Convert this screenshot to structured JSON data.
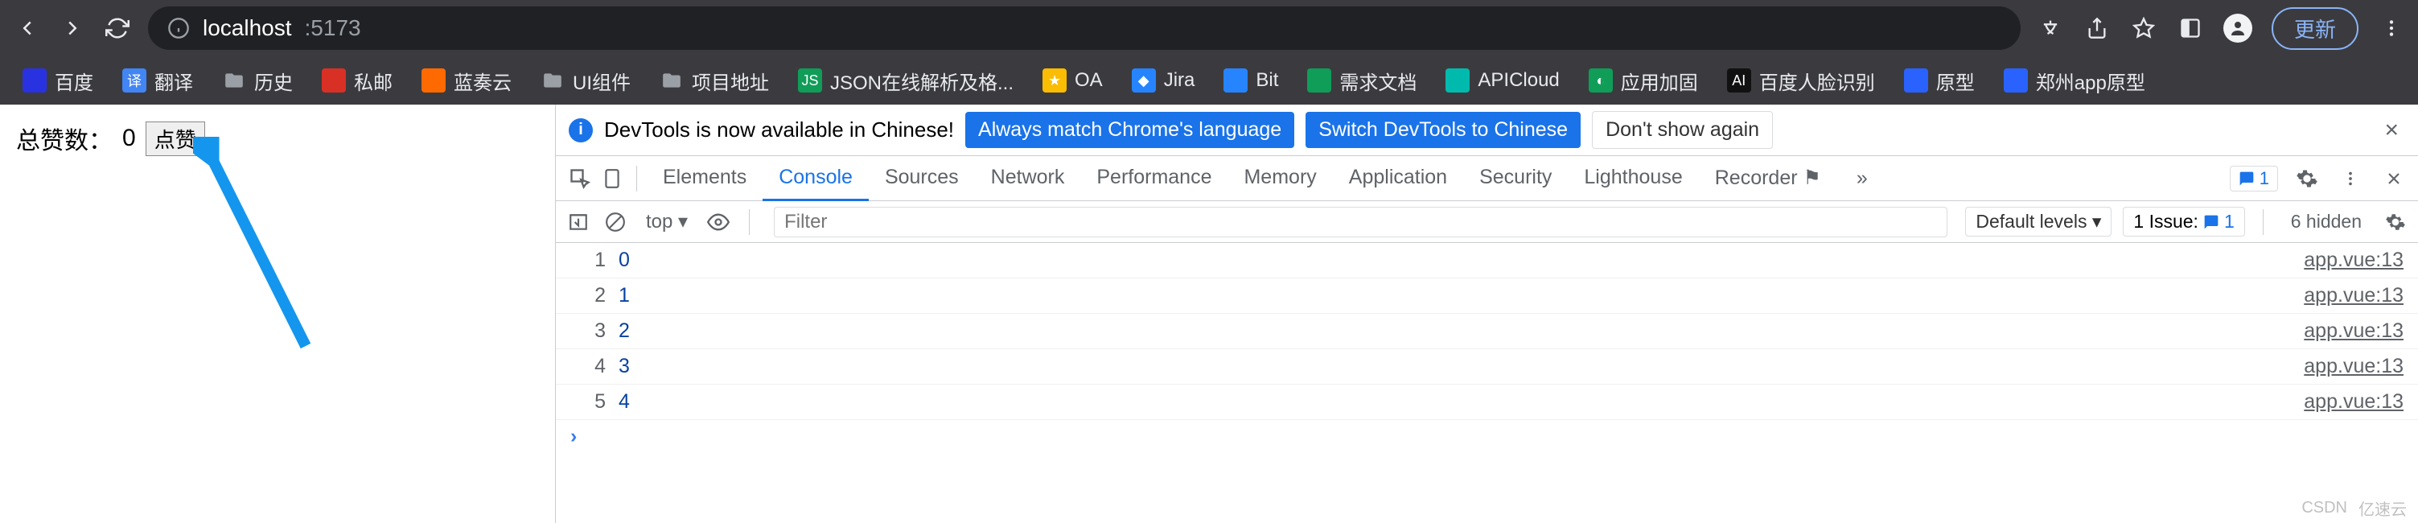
{
  "browser": {
    "url_host": "localhost",
    "url_port": ":5173",
    "update_label": "更新"
  },
  "bookmarks": [
    {
      "label": "百度",
      "color": "#2932e1"
    },
    {
      "label": "翻译",
      "color": "#4285f4",
      "badge": "译"
    },
    {
      "label": "历史",
      "folder": true
    },
    {
      "label": "私邮",
      "color": "#d93025"
    },
    {
      "label": "蓝奏云",
      "color": "#ff6a00"
    },
    {
      "label": "UI组件",
      "folder": true
    },
    {
      "label": "项目地址",
      "folder": true
    },
    {
      "label": "JSON在线解析及格...",
      "color": "#0f9d58",
      "badge": "JS"
    },
    {
      "label": "OA",
      "color": "#fbbc04",
      "badge": "★"
    },
    {
      "label": "Jira",
      "color": "#2684ff",
      "badge": "◆"
    },
    {
      "label": "Bit",
      "color": "#2684ff"
    },
    {
      "label": "需求文档",
      "color": "#0f9d58"
    },
    {
      "label": "APICloud",
      "color": "#00baad"
    },
    {
      "label": "应用加固",
      "color": "#0f9d58",
      "badge": "◐"
    },
    {
      "label": "百度人脸识别",
      "color": "#111",
      "badge": "AI"
    },
    {
      "label": "原型",
      "color": "#2962ff"
    },
    {
      "label": "郑州app原型",
      "color": "#2962ff"
    }
  ],
  "page": {
    "label": "总赞数：",
    "count": "0",
    "button": "点赞"
  },
  "devtools": {
    "notice": {
      "text": "DevTools is now available in Chinese!",
      "btn1": "Always match Chrome's language",
      "btn2": "Switch DevTools to Chinese",
      "btn3": "Don't show again"
    },
    "tabs": [
      "Elements",
      "Console",
      "Sources",
      "Network",
      "Performance",
      "Memory",
      "Application",
      "Security",
      "Lighthouse",
      "Recorder ⚑"
    ],
    "active_tab": "Console",
    "msg_count": "1",
    "filter": {
      "context": "top ▾",
      "placeholder": "Filter",
      "levels": "Default levels ▾",
      "issue_label": "1 Issue:",
      "issue_count": "1",
      "hidden": "6 hidden"
    },
    "logs": [
      {
        "n": "1",
        "v": "0",
        "src": "app.vue:13"
      },
      {
        "n": "2",
        "v": "1",
        "src": "app.vue:13"
      },
      {
        "n": "3",
        "v": "2",
        "src": "app.vue:13"
      },
      {
        "n": "4",
        "v": "3",
        "src": "app.vue:13"
      },
      {
        "n": "5",
        "v": "4",
        "src": "app.vue:13"
      }
    ],
    "prompt": "›"
  },
  "watermark": {
    "a": "CSDN",
    "b": "亿速云"
  }
}
